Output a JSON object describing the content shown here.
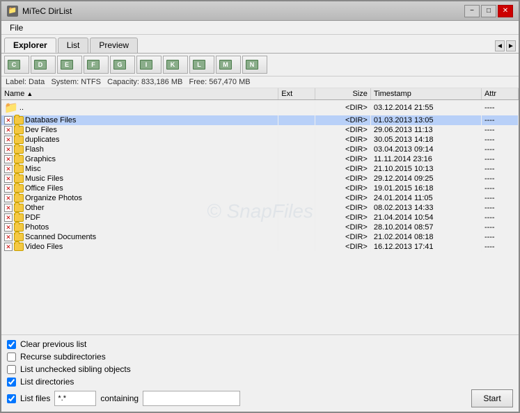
{
  "window": {
    "title": "MiTeC DirList",
    "icon": "📁"
  },
  "titlebar": {
    "minimize_label": "−",
    "maximize_label": "□",
    "close_label": "✕"
  },
  "menu": {
    "items": [
      "File"
    ]
  },
  "tabs": {
    "items": [
      "Explorer",
      "List",
      "Preview"
    ],
    "active": 0
  },
  "tab_nav": {
    "prev": "◄",
    "next": "►"
  },
  "toolbar": {
    "drives": [
      {
        "label": "C",
        "color": "#8aad8a"
      },
      {
        "label": "D",
        "color": "#8aad8a"
      },
      {
        "label": "E",
        "color": "#8aad8a"
      },
      {
        "label": "F",
        "color": "#8aad8a"
      },
      {
        "label": "G",
        "color": "#8aad8a"
      },
      {
        "label": "I",
        "color": "#8aad8a"
      },
      {
        "label": "K",
        "color": "#8aad8a"
      },
      {
        "label": "L",
        "color": "#8aad8a"
      },
      {
        "label": "M",
        "color": "#8aad8a"
      },
      {
        "label": "N",
        "color": "#8aad8a"
      }
    ]
  },
  "status": {
    "label": "Label: Data",
    "system": "System: NTFS",
    "capacity": "Capacity: 833,186 MB",
    "free": "Free: 567,470 MB"
  },
  "table": {
    "columns": [
      "Name",
      "Ext",
      "Size",
      "Timestamp",
      "Attr"
    ],
    "sort_col": "Name",
    "sort_dir": "asc",
    "rows": [
      {
        "checked": false,
        "is_up": true,
        "name": "..",
        "ext": "",
        "size": "<DIR>",
        "timestamp": "03.12.2014 21:55",
        "attr": "----",
        "selected": false
      },
      {
        "checked": true,
        "is_up": false,
        "name": "Database Files",
        "ext": "",
        "size": "<DIR>",
        "timestamp": "01.03.2013 13:05",
        "attr": "----",
        "selected": true
      },
      {
        "checked": true,
        "is_up": false,
        "name": "Dev Files",
        "ext": "",
        "size": "<DIR>",
        "timestamp": "29.06.2013 11:13",
        "attr": "----",
        "selected": false
      },
      {
        "checked": true,
        "is_up": false,
        "name": "duplicates",
        "ext": "",
        "size": "<DIR>",
        "timestamp": "30.05.2013 14:18",
        "attr": "----",
        "selected": false
      },
      {
        "checked": true,
        "is_up": false,
        "name": "Flash",
        "ext": "",
        "size": "<DIR>",
        "timestamp": "03.04.2013 09:14",
        "attr": "----",
        "selected": false
      },
      {
        "checked": true,
        "is_up": false,
        "name": "Graphics",
        "ext": "",
        "size": "<DIR>",
        "timestamp": "11.11.2014 23:16",
        "attr": "----",
        "selected": false
      },
      {
        "checked": true,
        "is_up": false,
        "name": "Misc",
        "ext": "",
        "size": "<DIR>",
        "timestamp": "21.10.2015 10:13",
        "attr": "----",
        "selected": false
      },
      {
        "checked": true,
        "is_up": false,
        "name": "Music Files",
        "ext": "",
        "size": "<DIR>",
        "timestamp": "29.12.2014 09:25",
        "attr": "----",
        "selected": false
      },
      {
        "checked": true,
        "is_up": false,
        "name": "Office Files",
        "ext": "",
        "size": "<DIR>",
        "timestamp": "19.01.2015 16:18",
        "attr": "----",
        "selected": false
      },
      {
        "checked": true,
        "is_up": false,
        "name": "Organize Photos",
        "ext": "",
        "size": "<DIR>",
        "timestamp": "24.01.2014 11:05",
        "attr": "----",
        "selected": false
      },
      {
        "checked": true,
        "is_up": false,
        "name": "Other",
        "ext": "",
        "size": "<DIR>",
        "timestamp": "08.02.2013 14:33",
        "attr": "----",
        "selected": false
      },
      {
        "checked": true,
        "is_up": false,
        "name": "PDF",
        "ext": "",
        "size": "<DIR>",
        "timestamp": "21.04.2014 10:54",
        "attr": "----",
        "selected": false
      },
      {
        "checked": true,
        "is_up": false,
        "name": "Photos",
        "ext": "",
        "size": "<DIR>",
        "timestamp": "28.10.2014 08:57",
        "attr": "----",
        "selected": false
      },
      {
        "checked": true,
        "is_up": false,
        "name": "Scanned Documents",
        "ext": "",
        "size": "<DIR>",
        "timestamp": "21.02.2014 08:18",
        "attr": "----",
        "selected": false
      },
      {
        "checked": true,
        "is_up": false,
        "name": "Video Files",
        "ext": "",
        "size": "<DIR>",
        "timestamp": "16.12.2013 17:41",
        "attr": "----",
        "selected": false
      }
    ]
  },
  "watermark": "© SnapFiles",
  "checkboxes": {
    "clear_previous": {
      "label": "Clear previous list",
      "checked": true
    },
    "recurse": {
      "label": "Recurse subdirectories",
      "checked": false
    },
    "list_unchecked": {
      "label": "List unchecked sibling objects",
      "checked": false
    },
    "list_dirs": {
      "label": "List directories",
      "checked": true
    },
    "list_files": {
      "label": "List files",
      "checked": true
    }
  },
  "inputs": {
    "filter": {
      "value": "*.*",
      "placeholder": ""
    },
    "containing": {
      "value": "",
      "placeholder": ""
    },
    "containing_label": "containing"
  },
  "buttons": {
    "start": "Start"
  }
}
